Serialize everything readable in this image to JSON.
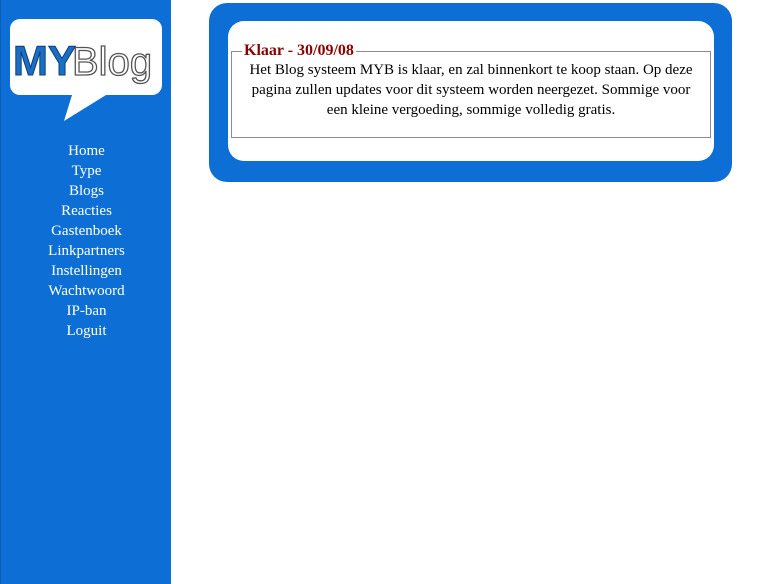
{
  "logo": {
    "part1": "MY",
    "part2": "Blog"
  },
  "colors": {
    "sidebar": "#0d6fd6",
    "accent_title": "#8b0000",
    "logo_my": "#1a6fc4",
    "logo_blog": "#ffffff"
  },
  "nav": {
    "items": [
      {
        "label": "Home"
      },
      {
        "label": "Type"
      },
      {
        "label": "Blogs"
      },
      {
        "label": "Reacties"
      },
      {
        "label": "Gastenboek"
      },
      {
        "label": "Linkpartners"
      },
      {
        "label": "Instellingen"
      },
      {
        "label": "Wachtwoord"
      },
      {
        "label": "IP-ban"
      },
      {
        "label": "Loguit"
      }
    ]
  },
  "post": {
    "title": "Klaar - 30/09/08",
    "body": "Het Blog systeem MYB is klaar, en zal binnenkort te koop staan. Op deze pagina zullen updates voor dit systeem worden neergezet. Sommige voor een kleine vergoeding, sommige volledig gratis."
  }
}
